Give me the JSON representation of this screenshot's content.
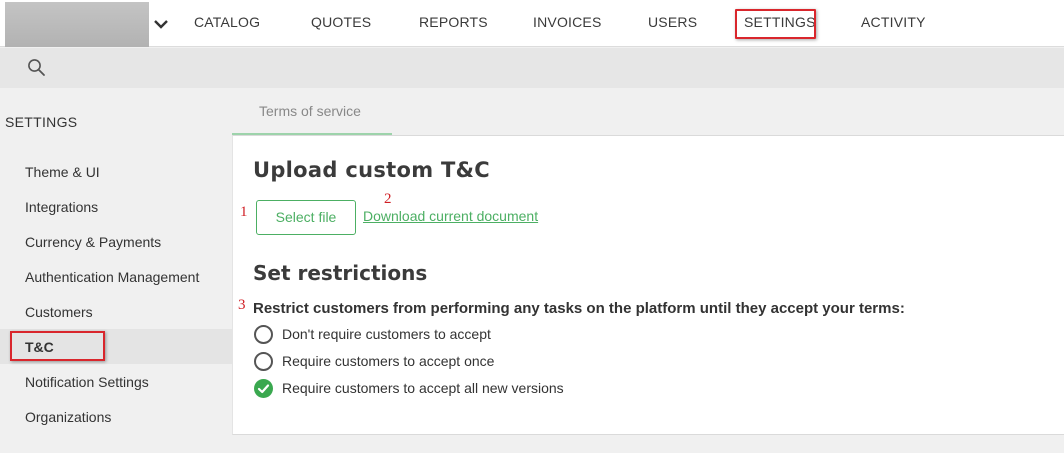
{
  "nav": {
    "items": [
      "CATALOG",
      "QUOTES",
      "REPORTS",
      "INVOICES",
      "USERS",
      "SETTINGS",
      "ACTIVITY"
    ],
    "active": "SETTINGS"
  },
  "search": {
    "icon": "search-icon"
  },
  "sidebar": {
    "title": "SETTINGS",
    "items": [
      "Theme & UI",
      "Integrations",
      "Currency & Payments",
      "Authentication Management",
      "Customers",
      "T&C",
      "Notification Settings",
      "Organizations"
    ],
    "active": "T&C"
  },
  "tab": {
    "label": "Terms of service"
  },
  "upload": {
    "heading": "Upload custom T&C",
    "select_button": "Select file",
    "download_link": "Download current document"
  },
  "restrictions": {
    "heading": "Set restrictions",
    "question": "Restrict customers from performing any tasks on the platform until they accept your terms:",
    "options": [
      {
        "label": "Don't require customers to accept",
        "selected": false
      },
      {
        "label": "Require customers to accept once",
        "selected": false
      },
      {
        "label": "Require customers to accept all new versions",
        "selected": true
      }
    ]
  },
  "annotations": [
    "1",
    "2",
    "3"
  ],
  "colors": {
    "accent": "#4caf63",
    "highlight": "#d9262c"
  }
}
